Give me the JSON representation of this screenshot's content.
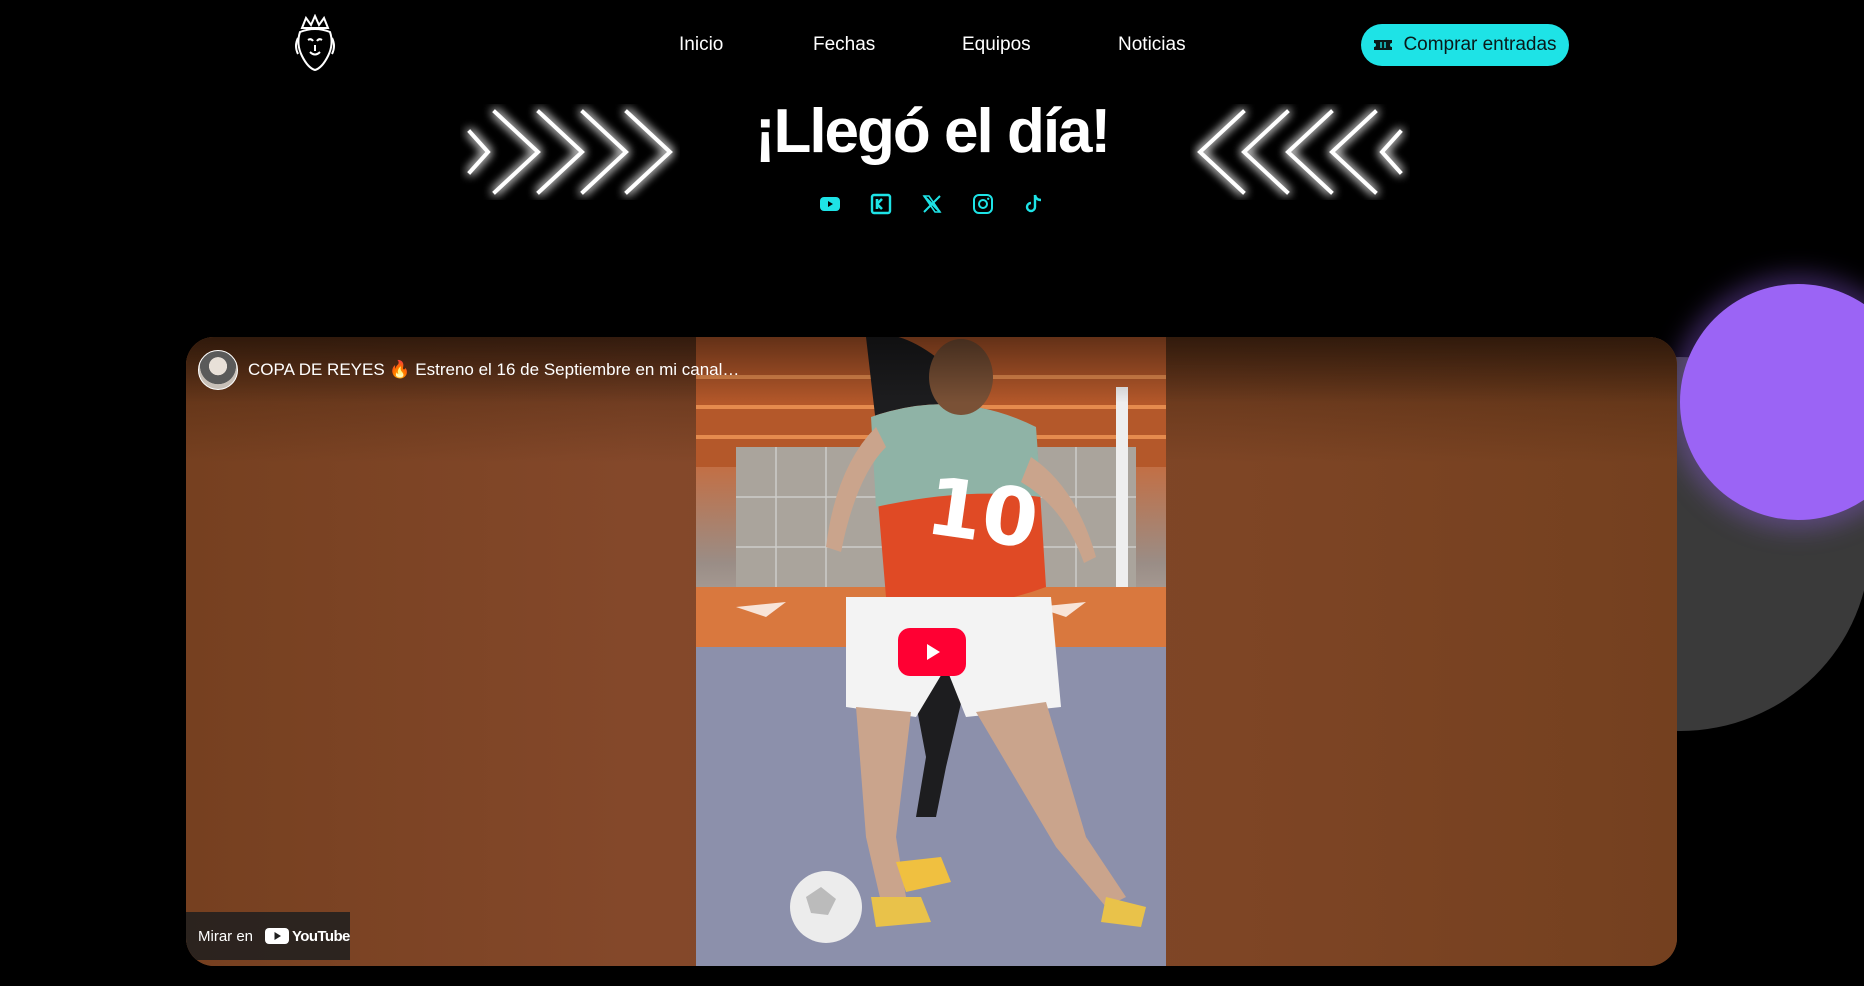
{
  "nav": {
    "links": [
      "Inicio",
      "Fechas",
      "Equipos",
      "Noticias"
    ],
    "cta_label": "Comprar entradas"
  },
  "hero": {
    "title": "¡Llegó el día!"
  },
  "social": [
    "youtube-icon",
    "kick-icon",
    "x-icon",
    "instagram-icon",
    "tiktok-icon"
  ],
  "video": {
    "title": "COPA DE REYES 🔥 Estreno el 16 de Septiembre en mi canal…",
    "watch_on": "Mirar en",
    "brand": "YouTube"
  },
  "colors": {
    "accent": "#1ee3e6",
    "purple": "#9b64f5",
    "youtube_red": "#ff0033"
  }
}
